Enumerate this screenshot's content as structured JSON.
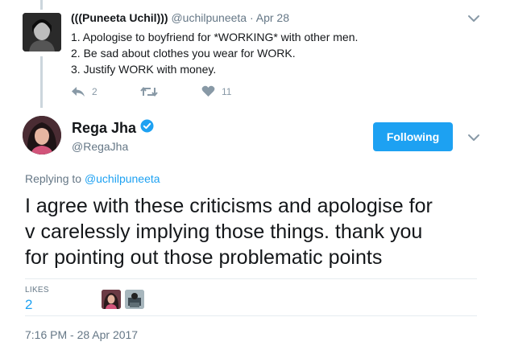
{
  "parent_tweet": {
    "display_name": "(((Puneeta Uchil)))",
    "handle": "@uchilpuneeta",
    "separator": " · ",
    "date": "Apr 28",
    "lines": [
      "1. Apologise to boyfriend for *WORKING* with other men.",
      "2. Be sad about clothes you wear for WORK.",
      "3. Justify WORK with money."
    ],
    "reply_count": "2",
    "retweet_count": "",
    "like_count": "11",
    "icons": [
      "reply-icon",
      "retweet-icon",
      "heart-icon",
      "chevron-down-icon"
    ]
  },
  "main_tweet": {
    "display_name": "Rega Jha",
    "handle": "@RegaJha",
    "follow_label": "Following",
    "replying_prefix": "Replying to ",
    "replying_to": "@uchilpuneeta",
    "text_lines": [
      "I agree with these criticisms and apologise for",
      "v carelessly implying those things. thank you",
      "for pointing out those problematic points"
    ],
    "likes_label": "LIKES",
    "likes_count": "2",
    "timestamp": "7:16 PM - 28 Apr 2017",
    "icons": [
      "verified-badge-icon",
      "chevron-down-icon"
    ]
  },
  "colors": {
    "accent": "#1da1f2",
    "secondary_text": "#657786",
    "action_icons": "#8899a6",
    "divider": "#e6ecf0"
  }
}
